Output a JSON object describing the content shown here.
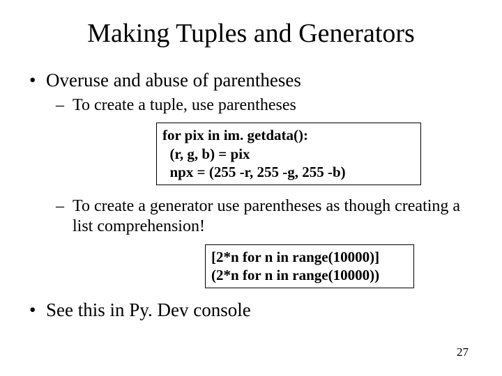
{
  "title": "Making Tuples and Generators",
  "bullets": {
    "b1": "Overuse and abuse of parentheses",
    "b1_sub1": "To create a tuple, use parentheses",
    "b1_sub2": "To create a generator use parentheses as though creating a list comprehension!",
    "b2": "See this in Py. Dev console"
  },
  "code": {
    "tuple": "for pix in im. getdata():\n  (r, g, b) = pix\n  npx = (255 -r, 255 -g, 255 -b)",
    "gen": "[2*n for n in range(10000)]\n(2*n for n in range(10000))"
  },
  "page_number": "27"
}
